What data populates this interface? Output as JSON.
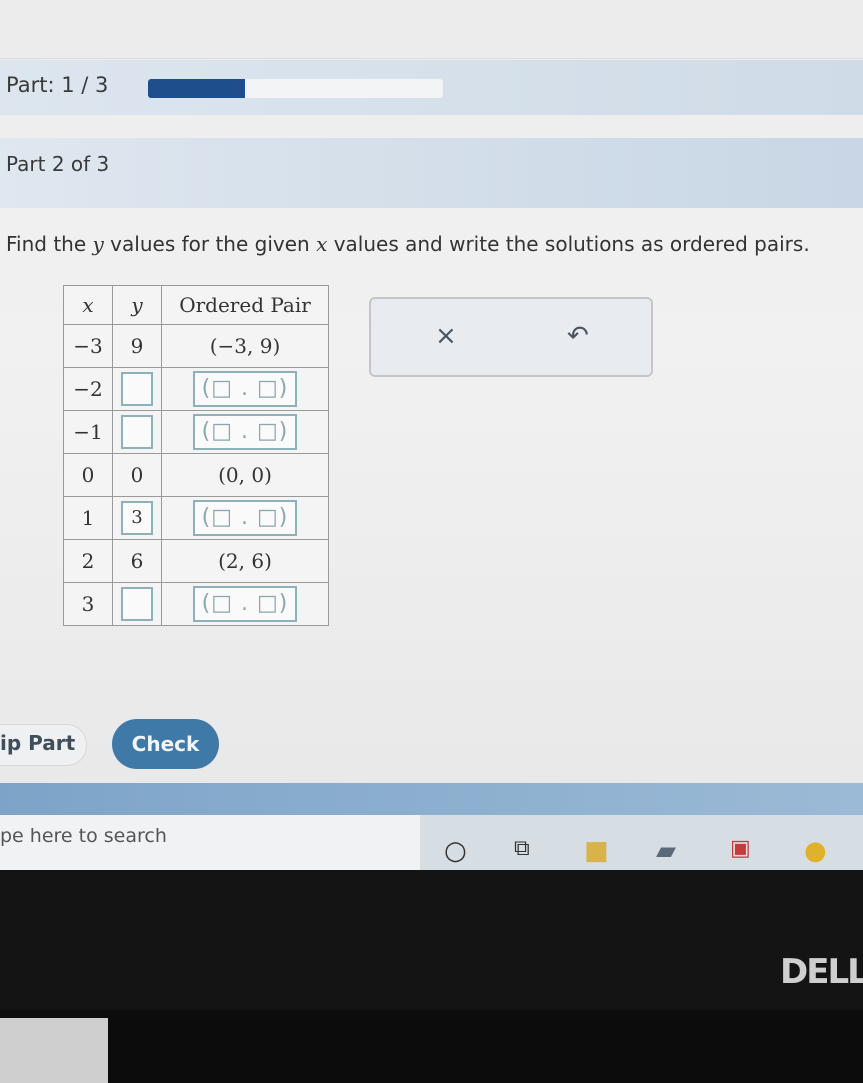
{
  "header": {
    "part_label": "Part: 1 / 3",
    "progress_fraction": 0.33,
    "subpart_label": "Part 2 of 3"
  },
  "question": {
    "prefix": "Find the ",
    "var_y": "y",
    "middle": " values for the given ",
    "var_x": "x",
    "suffix": " values and write the solutions as ordered pairs."
  },
  "table": {
    "headers": {
      "x": "x",
      "y": "y",
      "pair": "Ordered Pair"
    },
    "rows": [
      {
        "x": "−3",
        "y": "9",
        "pair": "(−3, 9)"
      },
      {
        "x": "−2",
        "y": "",
        "pair_placeholder": "(□ . □)"
      },
      {
        "x": "−1",
        "y": "",
        "pair_placeholder": "(□ . □)"
      },
      {
        "x": "0",
        "y": "0",
        "pair": "(0, 0)"
      },
      {
        "x": "1",
        "y": "3",
        "pair_placeholder": "(□ . □)"
      },
      {
        "x": "2",
        "y": "6",
        "pair": "(2, 6)"
      },
      {
        "x": "3",
        "y": "",
        "pair_placeholder": "(□ . □)"
      }
    ]
  },
  "toolbox": {
    "clear_symbol": "×",
    "undo_symbol": "↶"
  },
  "footer": {
    "skip_label": "ip Part",
    "check_label": "Check"
  },
  "taskbar": {
    "search_placeholder": "pe here to search",
    "icons": [
      "cortana-icon",
      "task-view-icon",
      "file-explorer-icon",
      "notes-icon",
      "mail-icon",
      "chrome-icon"
    ]
  },
  "bezel": {
    "brand": "DELL"
  },
  "colors": {
    "accent": "#1f4e8c",
    "check_button": "#3f79a8",
    "input_border": "#8eb0b8"
  }
}
